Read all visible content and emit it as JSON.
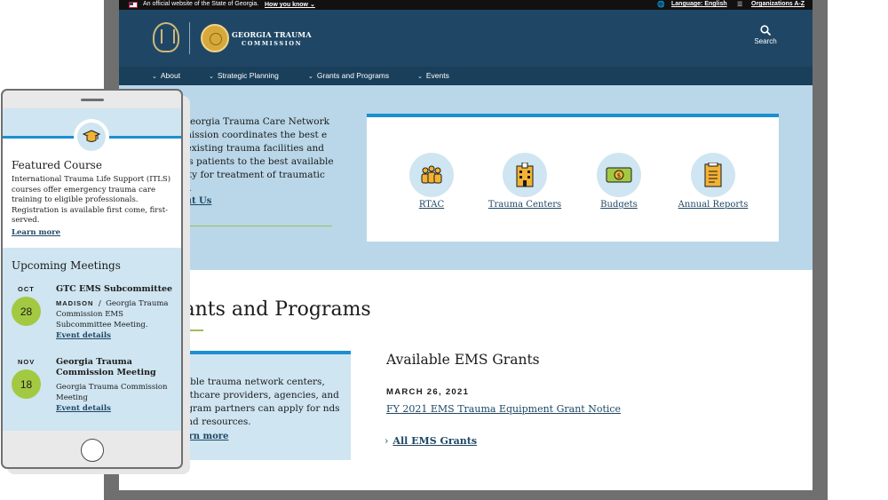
{
  "gov_banner": {
    "official": "An official website of the State of Georgia.",
    "how_you_know": "How you know",
    "language": "Language: English",
    "organizations": "Organizations A-Z"
  },
  "header": {
    "brand_line1": "GEORGIA TRAUMA",
    "brand_line2": "COMMISSION",
    "search_label": "Search"
  },
  "nav": {
    "items": [
      {
        "label": "About"
      },
      {
        "label": "Strategic Planning"
      },
      {
        "label": "Grants and Programs"
      },
      {
        "label": "Events"
      }
    ]
  },
  "hero": {
    "text": "e Georgia Trauma Care Network mmission coordinates the best e of existing trauma facilities and ects patients to the best available cility for treatment of traumatic ury.",
    "link": "out Us"
  },
  "quick_links": [
    {
      "label": "RTAC",
      "icon": "people-group-icon"
    },
    {
      "label": "Trauma Centers",
      "icon": "hospital-building-icon"
    },
    {
      "label": "Budgets",
      "icon": "money-bill-icon"
    },
    {
      "label": "Annual Reports",
      "icon": "report-document-icon"
    }
  ],
  "grants": {
    "section_title": "rants and Programs",
    "card_text": "gible trauma network centers, althcare providers, agencies, and ogram partners can apply for nds and resources.",
    "card_link": "arn more"
  },
  "ems": {
    "title": "Available EMS Grants",
    "date": "MARCH 26, 2021",
    "notice": "FY 2021 EMS Trauma Equipment Grant Notice",
    "all_link": "All EMS Grants"
  },
  "phone": {
    "featured": {
      "title": "Featured Course",
      "text": "International Trauma Life Support (ITLS) courses offer emergency trauma care training to eligible professionals. Registration is available first come, first-served.",
      "link": "Learn more",
      "icon": "graduation-cap-icon"
    },
    "meetings": {
      "title": "Upcoming Meetings",
      "events": [
        {
          "month": "OCT",
          "day": "28",
          "name": "GTC EMS Subcommittee",
          "city": "MADISON",
          "separator": "/",
          "desc": "Georgia Trauma Commission EMS Subcommittee Meeting.",
          "link": "Event details"
        },
        {
          "month": "NOV",
          "day": "18",
          "name": "Georgia Trauma Commission Meeting",
          "desc": "Georgia Trauma Commission Meeting",
          "link": "Event details"
        }
      ]
    }
  },
  "colors": {
    "header_bg": "#1f4765",
    "accent_blue": "#1d8fd0",
    "light_blue": "#cfe5f1",
    "green": "#a3c943"
  }
}
